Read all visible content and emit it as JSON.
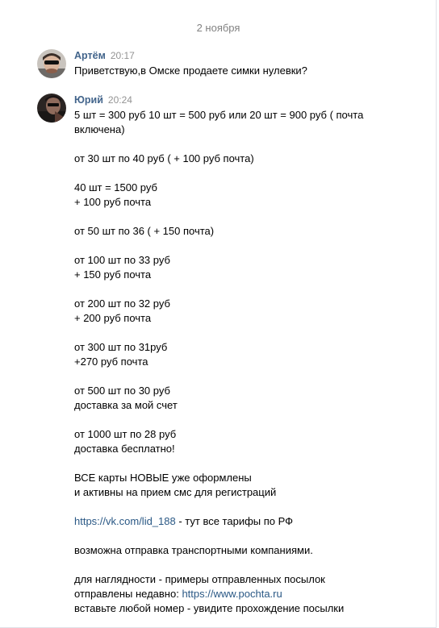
{
  "date_separator": "2 ноября",
  "messages": [
    {
      "author": "Артём",
      "time": "20:17",
      "text": "Приветствую,в Омске продаете симки нулевки?"
    },
    {
      "author": "Юрий",
      "time": "20:24",
      "lines": [
        "5 шт = 300 руб 10 шт = 500 руб или 20 шт = 900 руб ( почта",
        "включена)",
        "",
        "от 30 шт по 40 руб ( + 100 руб почта)",
        "",
        "40 шт = 1500 руб",
        "+ 100 руб почта",
        "",
        "от 50 шт по 36 ( + 150 почта)",
        "",
        "от 100 шт по 33 руб",
        "+ 150 руб почта",
        "",
        "от 200 шт по 32 руб",
        "+ 200 руб почта",
        "",
        "от 300 шт по 31руб",
        "+270 руб почта",
        "",
        "от 500 шт по 30 руб",
        "доставка за мой счет",
        "",
        "от 1000 шт по 28 руб",
        "доставка бесплатно!",
        "",
        "ВСЕ карты НОВЫЕ уже оформлены",
        "и активны на прием смс для регистраций",
        ""
      ],
      "link1": "https://vk.com/lid_188",
      "link1_suffix": " - тут все тарифы по РФ",
      "lines_after_link1": [
        "",
        "возможна отправка транспортными компаниями.",
        "",
        "для наглядности - примеры отправленных посылок"
      ],
      "link2_prefix": "отправлены недавно: ",
      "link2": "https://www.pochta.ru",
      "last_line": "вставьте любой номер - увидите прохождение посылки"
    }
  ],
  "colors": {
    "author": "#42648b",
    "link": "#2a5885",
    "time": "#939393",
    "date": "#828282"
  }
}
